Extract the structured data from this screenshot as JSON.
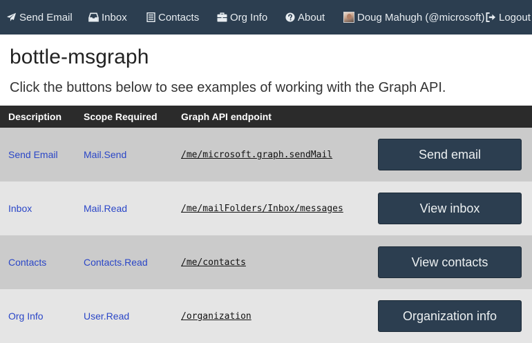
{
  "navbar": {
    "items": [
      {
        "label": "Send Email",
        "icon": "paper-plane-icon"
      },
      {
        "label": "Inbox",
        "icon": "inbox-tray-icon"
      },
      {
        "label": "Contacts",
        "icon": "list-icon"
      },
      {
        "label": "Org Info",
        "icon": "briefcase-icon"
      },
      {
        "label": "About",
        "icon": "question-circle-icon"
      }
    ],
    "user": {
      "label": "Doug Mahugh (@microsoft)",
      "icon": "user-avatar"
    },
    "logout": {
      "label": "Logout",
      "icon": "logout-icon"
    },
    "colors": {
      "background": "#2c3e50",
      "text": "#ecf0f1"
    }
  },
  "header": {
    "title": "bottle-msgraph",
    "subtitle": "Click the buttons below to see examples of working with the Graph API."
  },
  "table": {
    "columns": [
      "Description",
      "Scope Required",
      "Graph API endpoint"
    ],
    "rows": [
      {
        "description": "Send Email",
        "scope": "Mail.Send",
        "endpoint": "/me/microsoft.graph.sendMail",
        "button": "Send email"
      },
      {
        "description": "Inbox",
        "scope": "Mail.Read",
        "endpoint": "/me/mailFolders/Inbox/messages",
        "button": "View inbox"
      },
      {
        "description": "Contacts",
        "scope": "Contacts.Read",
        "endpoint": "/me/contacts",
        "button": "View contacts"
      },
      {
        "description": "Org Info",
        "scope": "User.Read",
        "endpoint": "/organization",
        "button": "Organization info"
      }
    ],
    "colors": {
      "header": "#2b2b2b",
      "row_dark": "#cbcbcb",
      "row_light": "#e5e5e5",
      "link": "#2a46c7",
      "button": "#2c3e50"
    }
  }
}
